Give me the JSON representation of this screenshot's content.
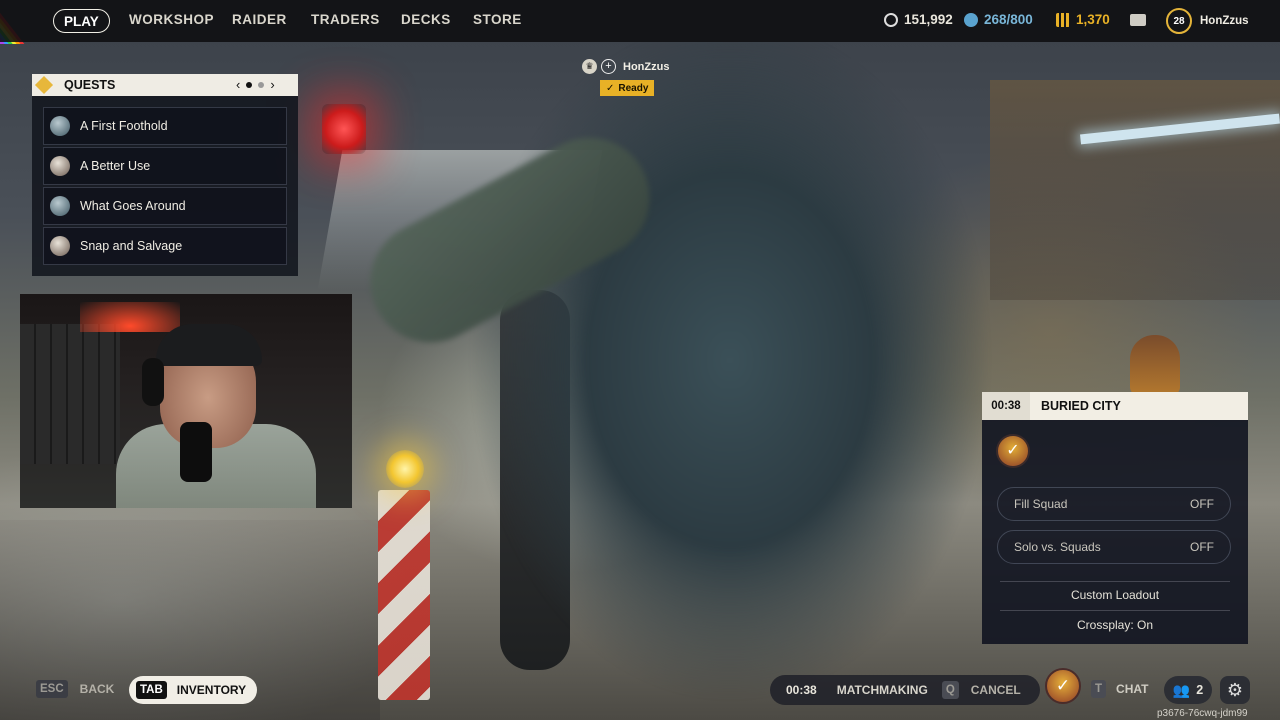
{
  "nav": {
    "play": "PLAY",
    "workshop": "WORKSHOP",
    "raider": "RAIDER",
    "traders": "TRADERS",
    "decks": "DECKS",
    "store": "STORE"
  },
  "currencies": {
    "coins": "151,992",
    "raider_tokens": "268/800",
    "cred": "1,370"
  },
  "profile": {
    "level": "28",
    "username": "HonZzus"
  },
  "quests": {
    "title": "QUESTS",
    "pager_prev": "‹",
    "pager_next": "›",
    "items": [
      {
        "label": "A First Foothold"
      },
      {
        "label": "A Better Use"
      },
      {
        "label": "What Goes Around"
      },
      {
        "label": "Snap and Salvage"
      }
    ]
  },
  "party": {
    "name": "HonZzus",
    "status": "Ready"
  },
  "matchmaking_panel": {
    "timer": "00:38",
    "map": "BURIED CITY",
    "options": [
      {
        "label": "Fill Squad",
        "value": "OFF"
      },
      {
        "label": "Solo vs. Squads",
        "value": "OFF"
      }
    ],
    "custom_loadout": "Custom Loadout",
    "crossplay": "Crossplay: On"
  },
  "bottom_bar": {
    "back_key": "ESC",
    "back_label": "BACK",
    "inventory_key": "TAB",
    "inventory_label": "INVENTORY",
    "mm_timer": "00:38",
    "mm_label": "MATCHMAKING",
    "cancel_key": "Q",
    "cancel_label": "CANCEL",
    "chat_key": "T",
    "chat_label": "CHAT",
    "party_count": "2"
  },
  "build_id": "p3676-76cwq-jdm99",
  "colors": {
    "accent_yellow": "#e8b126",
    "panel_dark": "#11141f",
    "header_light": "#f2eee4"
  }
}
